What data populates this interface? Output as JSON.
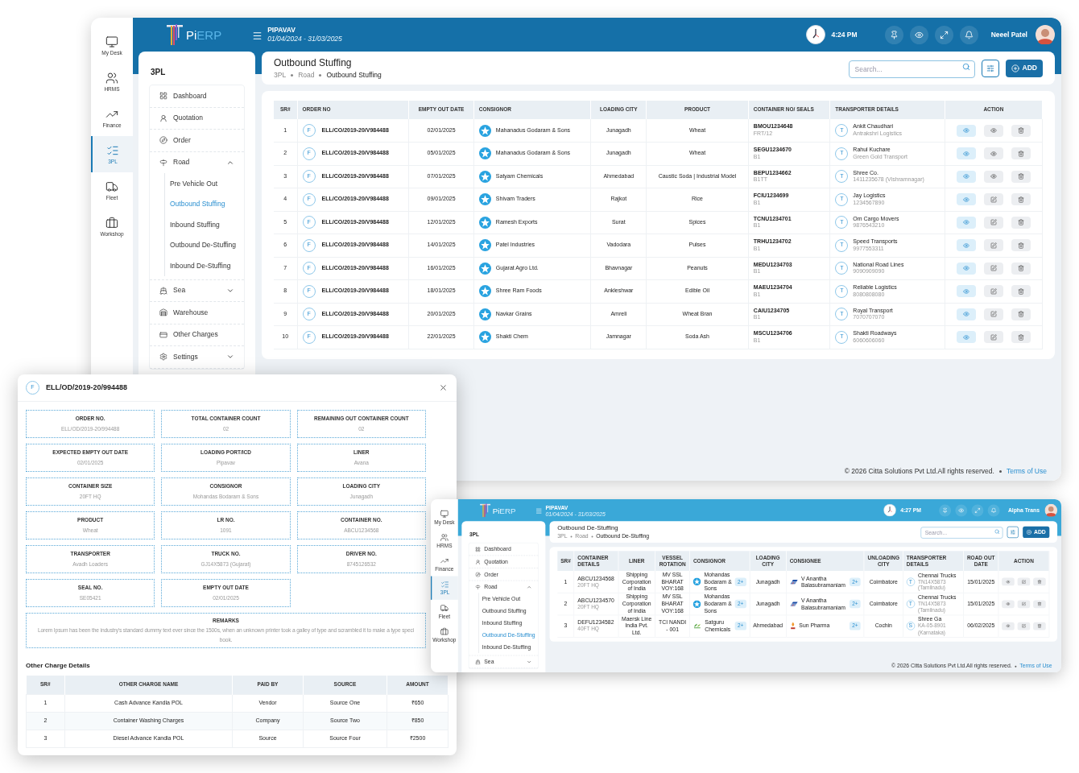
{
  "main_window": {
    "rail": [
      {
        "label": "My Desk",
        "selected": false
      },
      {
        "label": "HRMS",
        "selected": false
      },
      {
        "label": "Finance",
        "selected": false
      },
      {
        "label": "3PL",
        "selected": true
      },
      {
        "label": "Fleet",
        "selected": false
      },
      {
        "label": "Workshop",
        "selected": false
      }
    ],
    "header": {
      "logo_a": "Pi",
      "logo_b": "ERP",
      "company": "PIPAVAV",
      "period": "01/04/2024 - 31/03/2025",
      "time": "4:24 PM",
      "user": "Neeel Patel"
    },
    "sidebar": {
      "title": "3PL",
      "items": [
        {
          "label": "Dashboard"
        },
        {
          "label": "Quotation"
        },
        {
          "label": "Order"
        },
        {
          "label": "Road",
          "expanded": true,
          "children": [
            {
              "label": "Pre Vehicle Out",
              "selected": false
            },
            {
              "label": "Outbound Stuffing",
              "selected": true
            },
            {
              "label": "Inbound Stuffing",
              "selected": false
            },
            {
              "label": "Outbound De-Stuffing",
              "selected": false
            },
            {
              "label": "Inbound De-Stuffing",
              "selected": false
            }
          ]
        },
        {
          "label": "Sea",
          "expanded": false
        },
        {
          "label": "Warehouse"
        },
        {
          "label": "Other Charges"
        },
        {
          "label": "Settings",
          "expanded": false
        }
      ]
    },
    "page": {
      "title": "Outbound Stuffing",
      "breadcrumb": [
        "3PL",
        "Road",
        "Outbound Stuffing"
      ],
      "search_placeholder": "Search...",
      "add_label": "ADD"
    },
    "table": {
      "columns": [
        "SR#",
        "ORDER NO",
        "EMPTY OUT DATE",
        "CONSIGNOR",
        "LOADING CITY",
        "PRODUCT",
        "CONTAINER NO/ SEALS",
        "TRANSPORTER DETAILS",
        "ACTION"
      ],
      "rows": [
        {
          "kind": "view",
          "sr": "1",
          "badge": "F",
          "order_no": "ELL/CO/2019-20/V984488",
          "empty_out_date": "02/01/2025",
          "consignor": "Mahanadus Godaram & Sons",
          "loading_city": "Junagadh",
          "product": "Wheat",
          "container_no": "BMOU1234648",
          "seal": "FRT/12",
          "transporter_badge": "T",
          "transporter": "Ankit Chaudhari",
          "transporter_detail": "Antrakshri Logistics"
        },
        {
          "kind": "view",
          "sr": "2",
          "badge": "F",
          "order_no": "ELL/CO/2019-20/V984488",
          "empty_out_date": "05/01/2025",
          "consignor": "Mahanadus Godaram & Sons",
          "loading_city": "Junagadh",
          "product": "Wheat",
          "container_no": "SEGU1234670",
          "seal": "B1",
          "transporter_badge": "T",
          "transporter": "Rahul Kuchare",
          "transporter_detail": "Green Gold Transport"
        },
        {
          "kind": "view",
          "sr": "3",
          "badge": "F",
          "order_no": "ELL/CO/2019-20/V984488",
          "empty_out_date": "07/01/2025",
          "consignor": "Satyam Chemicals",
          "loading_city": "Ahmedabad",
          "product": "Caustic Soda | Industrial Model",
          "container_no": "BEPU1234662",
          "seal": "B1TT",
          "transporter_badge": "T",
          "transporter": "Shree Co.",
          "transporter_detail": "1411235678 (Vishramnagar)"
        },
        {
          "kind": "edit",
          "sr": "4",
          "badge": "F",
          "order_no": "ELL/CO/2019-20/V984488",
          "empty_out_date": "09/01/2025",
          "consignor": "Shivam Traders",
          "loading_city": "Rajkot",
          "product": "Rice",
          "container_no": "FCIU1234699",
          "seal": "B1",
          "transporter_badge": "T",
          "transporter": "Jay Logistics",
          "transporter_detail": "1234567890"
        },
        {
          "kind": "edit",
          "sr": "5",
          "badge": "F",
          "order_no": "ELL/CO/2019-20/V984488",
          "empty_out_date": "12/01/2025",
          "consignor": "Ramesh Exports",
          "loading_city": "Surat",
          "product": "Spices",
          "container_no": "TCNU1234701",
          "seal": "B1",
          "transporter_badge": "T",
          "transporter": "Om Cargo Movers",
          "transporter_detail": "9876543210"
        },
        {
          "kind": "edit",
          "sr": "6",
          "badge": "F",
          "order_no": "ELL/CO/2019-20/V984488",
          "empty_out_date": "14/01/2025",
          "consignor": "Patel Industries",
          "loading_city": "Vadodara",
          "product": "Pulses",
          "container_no": "TRHU1234702",
          "seal": "B1",
          "transporter_badge": "T",
          "transporter": "Speed Transports",
          "transporter_detail": "9977553311"
        },
        {
          "kind": "edit",
          "sr": "7",
          "badge": "F",
          "order_no": "ELL/CO/2019-20/V984488",
          "empty_out_date": "16/01/2025",
          "consignor": "Gujarat Agro Ltd.",
          "loading_city": "Bhavnagar",
          "product": "Peanuts",
          "container_no": "MEDU1234703",
          "seal": "B1",
          "transporter_badge": "T",
          "transporter": "National Road Lines",
          "transporter_detail": "9090909090"
        },
        {
          "kind": "edit",
          "sr": "8",
          "badge": "F",
          "order_no": "ELL/CO/2019-20/V984488",
          "empty_out_date": "18/01/2025",
          "consignor": "Shree Ram Foods",
          "loading_city": "Ankleshwar",
          "product": "Edible Oil",
          "container_no": "MAEU1234704",
          "seal": "B1",
          "transporter_badge": "T",
          "transporter": "Reliable Logistics",
          "transporter_detail": "8080808080"
        },
        {
          "kind": "edit",
          "sr": "9",
          "badge": "F",
          "order_no": "ELL/CO/2019-20/V984488",
          "empty_out_date": "20/01/2025",
          "consignor": "Navkar Grains",
          "loading_city": "Amreli",
          "product": "Wheat Bran",
          "container_no": "CAIU1234705",
          "seal": "B1",
          "transporter_badge": "T",
          "transporter": "Royal Transport",
          "transporter_detail": "7070707070"
        },
        {
          "kind": "edit",
          "sr": "10",
          "badge": "F",
          "order_no": "ELL/CO/2019-20/V984488",
          "empty_out_date": "22/01/2025",
          "consignor": "Shakti Chem",
          "loading_city": "Jamnagar",
          "product": "Soda Ash",
          "container_no": "MSCU1234706",
          "seal": "B1",
          "transporter_badge": "T",
          "transporter": "Shakti Roadways",
          "transporter_detail": "6060606060"
        }
      ]
    },
    "footer": {
      "copyright": "© 2026 Citta Solutions Pvt Ltd.All rights reserved.",
      "link": "Terms of Use"
    }
  },
  "detail_dialog": {
    "badge": "F",
    "title": "ELL/OD/2019-20/994488",
    "fields": [
      {
        "label": "ORDER NO.",
        "value": "ELL/OD/2019-20/994488"
      },
      {
        "label": "TOTAL CONTAINER COUNT",
        "value": "02"
      },
      {
        "label": "REMAINING OUT CONTAINER COUNT",
        "value": "02"
      },
      {
        "label": "EXPECTED EMPTY OUT DATE",
        "value": "02/01/2025"
      },
      {
        "label": "LOADING PORT/ICD",
        "value": "Pipavav"
      },
      {
        "label": "LINER",
        "value": "Avana"
      },
      {
        "label": "CONTAINER SIZE",
        "value": "20FT HQ"
      },
      {
        "label": "CONSIGNOR",
        "value": "Mohandas Bodaram & Sons"
      },
      {
        "label": "LOADING CITY",
        "value": "Junagadh"
      },
      {
        "label": "PRODUCT",
        "value": "Wheat"
      },
      {
        "label": "LR NO.",
        "value": "1091"
      },
      {
        "label": "CONTAINER NO.",
        "value": "ABCU1234568"
      },
      {
        "label": "TRANSPORTER",
        "value": "Avadh Loaders"
      },
      {
        "label": "TRUCK NO.",
        "value": "GJ14X5873 (Gujarat)"
      },
      {
        "label": "DRIVER NO.",
        "value": "8745126532"
      },
      {
        "label": "SEAL NO.",
        "value": "SE05421"
      },
      {
        "label": "EMPTY OUT DATE",
        "value": "02/01/2025"
      }
    ],
    "remarks": {
      "label": "REMARKS",
      "lines": [
        "Lorem Ipsum has been the industry's standard dummy text ever since the 1500s, when an unknown printer took a galley of type and scrambled it to make a type speci",
        "book."
      ]
    },
    "charges": {
      "title": "Other Charge Details",
      "columns": [
        "SR#",
        "OTHER CHARGE NAME",
        "PAID BY",
        "SOURCE",
        "AMOUNT"
      ],
      "rows": [
        [
          "1",
          "Cash Advance Kandla POL",
          "Vendor",
          "Source One",
          "₹650"
        ],
        [
          "2",
          "Container Washing Charges",
          "Company",
          "Source Two",
          "₹850"
        ],
        [
          "3",
          "Diesel Advance Kandla POL",
          "Source",
          "Source Four",
          "₹2500"
        ]
      ]
    }
  },
  "second_window": {
    "rail": [
      {
        "label": "My Desk",
        "selected": false
      },
      {
        "label": "HRMS",
        "selected": false
      },
      {
        "label": "Finance",
        "selected": false
      },
      {
        "label": "3PL",
        "selected": true
      },
      {
        "label": "Fleet",
        "selected": false
      },
      {
        "label": "Workshop",
        "selected": false
      }
    ],
    "header": {
      "logo_a": "Pi",
      "logo_b": "ERP",
      "company": "PIPAVAV",
      "period": "01/04/2024 - 31/03/2025",
      "time": "4:27 PM",
      "user": "Alpha Trans"
    },
    "sidebar": {
      "title": "3PL",
      "items": [
        {
          "label": "Dashboard"
        },
        {
          "label": "Quotation"
        },
        {
          "label": "Order"
        },
        {
          "label": "Road",
          "expanded": true,
          "children": [
            {
              "label": "Pre Vehicle Out",
              "selected": false
            },
            {
              "label": "Outbound Stuffing",
              "selected": false
            },
            {
              "label": "Inbound Stuffing",
              "selected": false
            },
            {
              "label": "Outbound De-Stuffing",
              "selected": true
            },
            {
              "label": "Inbound De-Stuffing",
              "selected": false
            }
          ]
        },
        {
          "label": "Sea",
          "expanded": false
        }
      ]
    },
    "page": {
      "title": "Outbound De-Stuffing",
      "breadcrumb": [
        "3PL",
        "Road",
        "Outbound De-Stuffing"
      ],
      "search_placeholder": "Search...",
      "add_label": "ADD"
    },
    "table": {
      "columns": [
        "SR#",
        "CONTAINER DETAILS",
        "LINER",
        "VESSEL ROTATION",
        "CONSIGNOR",
        "LOADING CITY",
        "CONSIGNEE",
        "UNLOADING CITY",
        "TRANSPORTER DETAILS",
        "ROAD OUT DATE",
        "ACTION"
      ],
      "rows": [
        {
          "sr": "1",
          "container_no": "ABCU1234568",
          "container_size": "20FT HQ",
          "liner": "Shipping Corporation of India",
          "vessel_rotation": "MV SSL BHARAT VOY:168",
          "consignor": "Mohandas Bodaram & Sons",
          "consignor_more": "2+",
          "loading_city": "Junagadh",
          "consignee": "V Anantha Balasubramaniam",
          "consignee_more": "2+",
          "unloading_city": "Coimbatore",
          "transporter_badge": "T",
          "transporter": "Chennai Trucks",
          "transporter_detail": "TN14X5873 (Tamilnadu)",
          "road_out_date": "15/01/2025"
        },
        {
          "sr": "2",
          "container_no": "ABCU1234570",
          "container_size": "20FT HQ",
          "liner": "Shipping Corporation of India",
          "vessel_rotation": "MV SSL BHARAT VOY:168",
          "consignor": "Mohandas Bodaram & Sons",
          "consignor_more": "2+",
          "loading_city": "Junagadh",
          "consignee": "V Anantha Balasubramaniam",
          "consignee_more": "2+",
          "unloading_city": "Coimbatore",
          "transporter_badge": "T",
          "transporter": "Chennai Trucks",
          "transporter_detail": "TN14X5873 (Tamilnadu)",
          "road_out_date": "15/01/2025"
        },
        {
          "sr": "3",
          "container_no": "DEFU1234582",
          "container_size": "40FT HQ",
          "liner": "Maersk Line India Pvt. Ltd.",
          "vessel_rotation": "TCI NANDI - 001",
          "consignor": "Satguru Chemicals",
          "consignor_more": "2+",
          "loading_city": "Ahmedabad",
          "consignee": "Sun Pharma",
          "consignee_more": "2+",
          "unloading_city": "Cochin",
          "transporter_badge": "S",
          "transporter": "Shree Ga",
          "transporter_detail": "KA-05-8901 (Karnataka)",
          "road_out_date": "06/02/2025"
        }
      ]
    },
    "footer": {
      "copyright": "© 2026 Citta Solutions Pvt Ltd.All rights reserved.",
      "link": "Terms of Use"
    }
  }
}
